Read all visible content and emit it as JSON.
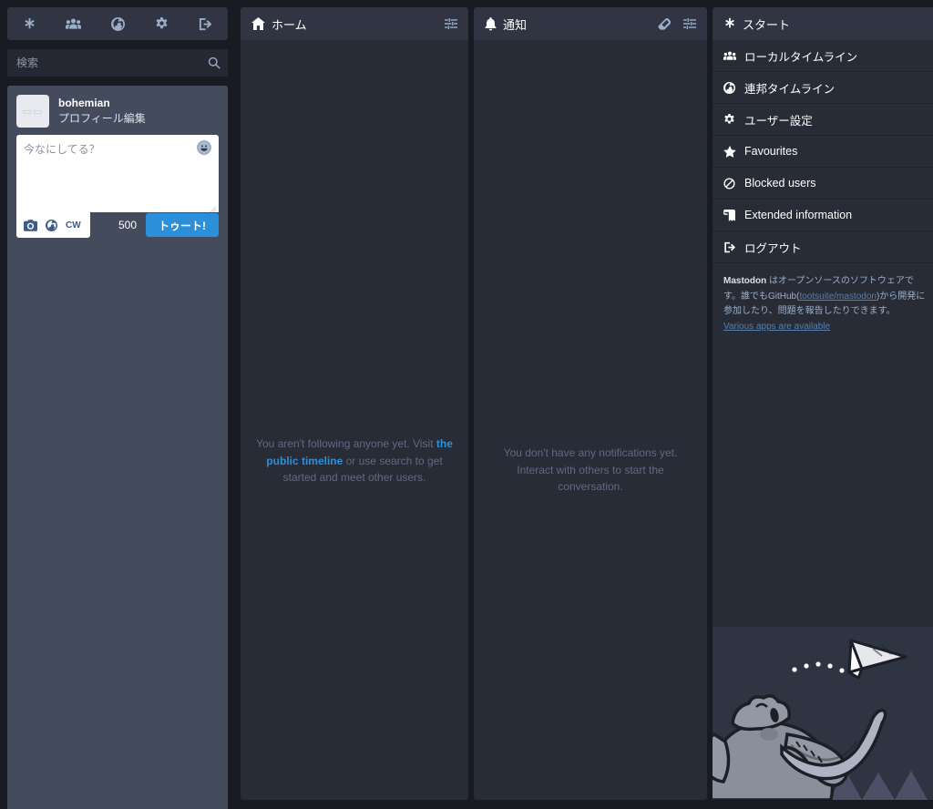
{
  "drawer": {
    "tabs": [
      {
        "name": "start-tab",
        "icon": "asterisk-icon",
        "label": "スタート"
      },
      {
        "name": "local-timeline-tab",
        "icon": "users-icon",
        "label": "ローカルタイムライン"
      },
      {
        "name": "federated-timeline-tab",
        "icon": "globe-icon",
        "label": "連邦タイムライン"
      },
      {
        "name": "preferences-tab",
        "icon": "gear-icon",
        "label": "ユーザー設定"
      },
      {
        "name": "logout-tab",
        "icon": "sign-out-icon",
        "label": "ログアウト"
      }
    ],
    "search": {
      "placeholder": "検索",
      "value": "",
      "icon": "search-icon"
    },
    "account": {
      "name": "bohemian",
      "edit_label": "プロフィール編集",
      "avatar_alt": "avatar"
    },
    "composer": {
      "placeholder": "今なにしてる？",
      "value": "",
      "emoji_icon": "emoji-smile-icon",
      "media_icon": "camera-icon",
      "privacy_icon": "globe-icon",
      "cw_label": "CW",
      "char_count": "500",
      "submit_label": "トゥート!"
    }
  },
  "columns": {
    "home": {
      "title": "ホーム",
      "icon": "home-icon",
      "settings_icon": "sliders-icon",
      "empty": {
        "before_link": "You aren't following anyone yet. Visit ",
        "link_text": "the public timeline",
        "after_link": " or use search to get started and meet other users."
      }
    },
    "notifications": {
      "title": "通知",
      "icon": "bell-icon",
      "clear_icon": "eraser-icon",
      "settings_icon": "sliders-icon",
      "empty": {
        "text": "You don't have any notifications yet. Interact with others to start the conversation."
      }
    },
    "start": {
      "title": "スタート",
      "icon": "asterisk-icon",
      "items": [
        {
          "label": "ローカルタイムライン",
          "icon": "users-icon",
          "name": "start-item-local-timeline"
        },
        {
          "label": "連邦タイムライン",
          "icon": "globe-icon",
          "name": "start-item-federated-timeline"
        },
        {
          "label": "ユーザー設定",
          "icon": "gear-icon",
          "name": "start-item-preferences"
        },
        {
          "label": "Favourites",
          "icon": "star-icon",
          "name": "start-item-favourites"
        },
        {
          "label": "Blocked users",
          "icon": "ban-icon",
          "name": "start-item-blocked-users"
        },
        {
          "label": "Extended information",
          "icon": "book-icon",
          "name": "start-item-extended-information"
        },
        {
          "label": "ログアウト",
          "icon": "sign-out-icon",
          "name": "start-item-logout"
        }
      ],
      "note": {
        "brand": "Mastodon",
        "text_1": " はオープンソースのソフトウェアです。誰でもGitHub(",
        "repo_link": "tootsuite/mastodon",
        "text_2": ")から開発に参加したり、問題を報告したりできます。 ",
        "apps_link": "Various apps are available"
      }
    }
  },
  "colors": {
    "page_bg": "#191b22",
    "column_bg": "#282c37",
    "header_bg": "#313543",
    "drawer_bg": "#444b5d",
    "accent": "#2b90d9",
    "text_primary": "#ffffff",
    "text_secondary": "#9baec8",
    "text_muted": "#606984"
  }
}
